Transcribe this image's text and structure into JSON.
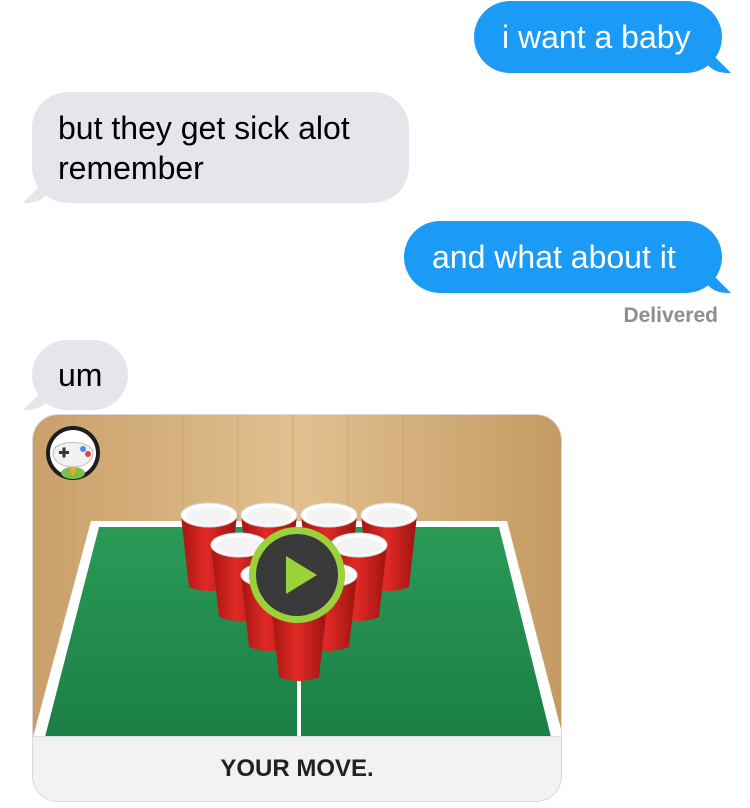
{
  "messages": [
    {
      "id": "b1",
      "direction": "sent",
      "lines": [
        "i want a baby"
      ]
    },
    {
      "id": "b2",
      "direction": "received",
      "lines": [
        "but they get sick alot",
        "remember"
      ]
    },
    {
      "id": "b3",
      "direction": "sent",
      "lines": [
        "and what about it"
      ]
    },
    {
      "id": "b4",
      "direction": "received",
      "lines": [
        "um"
      ]
    }
  ],
  "status": "Delivered",
  "game_card": {
    "caption": "YOUR MOVE.",
    "app_icon": "gamepigeon-bird-icon",
    "play_icon": "play-icon"
  },
  "colors": {
    "sent_bubble": "#1b9bf5",
    "received_bubble": "#e6e5eb",
    "status_text": "#8e8e93",
    "play_ring": "#9bd13a",
    "table": "#1f8a4c",
    "cup": "#c9201e"
  }
}
